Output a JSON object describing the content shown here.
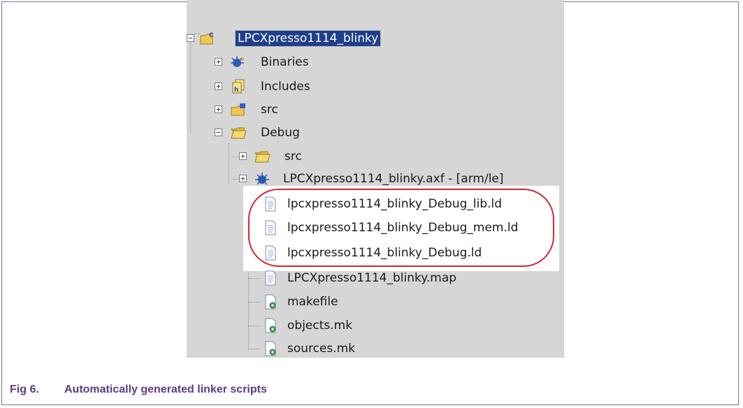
{
  "tree": {
    "project": {
      "label": "LPCXpresso1114_blinky",
      "expander": "−"
    },
    "binaries": {
      "label": "Binaries",
      "expander": "+"
    },
    "includes": {
      "label": "Includes",
      "expander": "+"
    },
    "src": {
      "label": "src",
      "expander": "+"
    },
    "debug": {
      "label": "Debug",
      "expander": "−"
    },
    "debug_src": {
      "label": "src",
      "expander": "+"
    },
    "axf": {
      "label": "LPCXpresso1114_blinky.axf - [arm/le]",
      "expander": "+"
    },
    "files": [
      {
        "label": "lpcxpresso1114_blinky_Debug_lib.ld"
      },
      {
        "label": "lpcxpresso1114_blinky_Debug_mem.ld"
      },
      {
        "label": "lpcxpresso1114_blinky_Debug.ld"
      },
      {
        "label": "LPCXpresso1114_blinky.map"
      },
      {
        "label": "makefile"
      },
      {
        "label": "objects.mk"
      },
      {
        "label": "sources.mk"
      }
    ]
  },
  "caption": {
    "number": "Fig 6.",
    "text": "Automatically generated linker scripts"
  },
  "colors": {
    "highlight_ring": "#d4282d",
    "caption": "#5a3d87",
    "selection": "#1f3f8a"
  },
  "icons": {
    "project": "c-project-folder-icon",
    "binaries": "binaries-icon",
    "includes": "includes-icon",
    "source_folder": "source-folder-icon",
    "folder": "folder-icon",
    "executable": "axf-executable-icon",
    "text_file": "text-file-icon",
    "makefile": "makefile-icon"
  }
}
